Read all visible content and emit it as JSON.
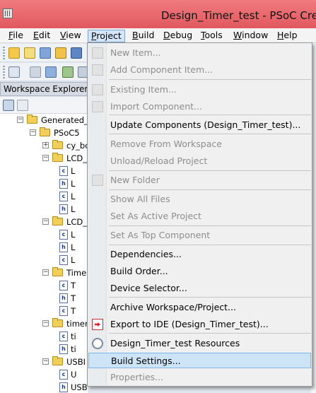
{
  "window": {
    "title": "Design_Timer_test - PSoC Cre"
  },
  "menubar": [
    {
      "label": "File",
      "key": "F",
      "rest": "ile"
    },
    {
      "label": "Edit",
      "key": "E",
      "rest": "dit"
    },
    {
      "label": "View",
      "key": "V",
      "rest": "iew"
    },
    {
      "label": "Project",
      "key": "P",
      "rest": "roject"
    },
    {
      "label": "Build",
      "key": "B",
      "rest": "uild"
    },
    {
      "label": "Debug",
      "key": "D",
      "rest": "ebug"
    },
    {
      "label": "Tools",
      "key": "T",
      "rest": "ools"
    },
    {
      "label": "Window",
      "key": "W",
      "rest": "indow"
    },
    {
      "label": "Help",
      "key": "H",
      "rest": "elp"
    }
  ],
  "workspace": {
    "header": "Workspace Explorer",
    "tree": [
      {
        "type": "folder",
        "label": "Generated_S"
      },
      {
        "type": "folder",
        "label": "PSoC5"
      },
      {
        "type": "folder",
        "label": "cy_bo"
      },
      {
        "type": "folder",
        "label": "LCD_"
      },
      {
        "type": "c",
        "label": "L"
      },
      {
        "type": "h",
        "label": "L"
      },
      {
        "type": "c",
        "label": "L"
      },
      {
        "type": "h",
        "label": "L"
      },
      {
        "type": "folder",
        "label": "LCD_"
      },
      {
        "type": "c",
        "label": "L"
      },
      {
        "type": "h",
        "label": "L"
      },
      {
        "type": "c",
        "label": "L"
      },
      {
        "type": "folder",
        "label": "Time"
      },
      {
        "type": "c",
        "label": "T"
      },
      {
        "type": "h",
        "label": "T"
      },
      {
        "type": "c",
        "label": "T"
      },
      {
        "type": "folder",
        "label": "timer"
      },
      {
        "type": "c",
        "label": "ti"
      },
      {
        "type": "h",
        "label": "ti"
      },
      {
        "type": "folder",
        "label": "USBI"
      },
      {
        "type": "c",
        "label": "U"
      },
      {
        "type": "h",
        "label": "USBUART_h"
      }
    ]
  },
  "project_menu": {
    "items": [
      {
        "label": "New Item...",
        "disabled": true
      },
      {
        "label": "Add Component Item...",
        "disabled": true
      },
      {
        "label": "Existing Item...",
        "disabled": true
      },
      {
        "label": "Import Component...",
        "disabled": true
      },
      {
        "label": "Update Components (Design_Timer_test)...",
        "disabled": false
      },
      {
        "label": "Remove From Workspace",
        "disabled": true
      },
      {
        "label": "Unload/Reload Project",
        "disabled": true
      },
      {
        "label": "New Folder",
        "disabled": true
      },
      {
        "label": "Show All Files",
        "disabled": true
      },
      {
        "label": "Set As Active Project",
        "disabled": true
      },
      {
        "label": "Set As Top Component",
        "disabled": true
      },
      {
        "label": "Dependencies...",
        "disabled": false
      },
      {
        "label": "Build Order...",
        "disabled": false
      },
      {
        "label": "Device Selector...",
        "disabled": false
      },
      {
        "label": "Archive Workspace/Project...",
        "disabled": false
      },
      {
        "label": "Export to IDE (Design_Timer_test)...",
        "disabled": false
      },
      {
        "label": "Design_Timer_test Resources",
        "disabled": false
      },
      {
        "label": "Build Settings...",
        "disabled": false,
        "highlighted": true
      },
      {
        "label": "Properties...",
        "disabled": true
      }
    ]
  },
  "colors": {
    "titlebar": "#e0595f",
    "menu_highlight": "#cde4f7"
  }
}
